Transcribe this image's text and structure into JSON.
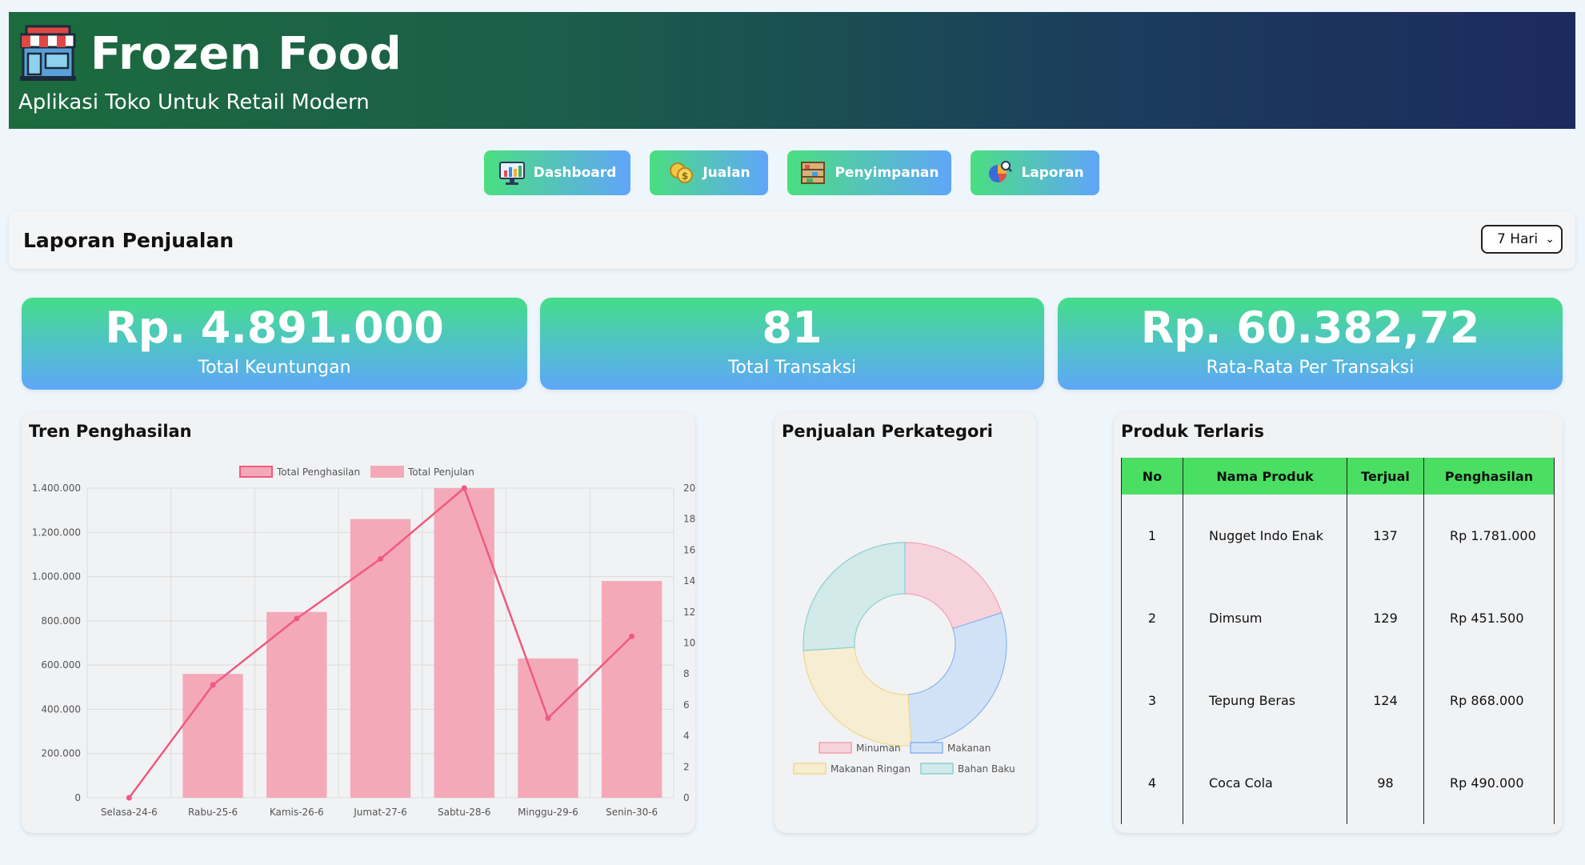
{
  "header": {
    "title": "Frozen Food",
    "subtitle": "Aplikasi Toko Untuk Retail Modern"
  },
  "nav": [
    {
      "label": "Dashboard",
      "icon": "monitor-chart-icon"
    },
    {
      "label": "Jualan",
      "icon": "coins-icon"
    },
    {
      "label": "Penyimpanan",
      "icon": "storage-shelf-icon"
    },
    {
      "label": "Laporan",
      "icon": "analytics-report-icon"
    }
  ],
  "report": {
    "title": "Laporan Penjualan",
    "period_selected": "7 Hari"
  },
  "stats": [
    {
      "value": "Rp. 4.891.000",
      "label": "Total Keuntungan"
    },
    {
      "value": "81",
      "label": "Total Transaksi"
    },
    {
      "value": "Rp. 60.382,72",
      "label": "Rata-Rata Per Transaksi"
    }
  ],
  "trend_panel": {
    "title": "Tren Penghasilan"
  },
  "category_panel": {
    "title": "Penjualan Perkategori"
  },
  "top_products": {
    "title": "Produk Terlaris",
    "headers": [
      "No",
      "Nama Produk",
      "Terjual",
      "Penghasilan"
    ],
    "rows": [
      [
        "1",
        "Nugget Indo Enak",
        "137",
        "Rp 1.781.000"
      ],
      [
        "2",
        "Dimsum",
        "129",
        "Rp 451.500"
      ],
      [
        "3",
        "Tepung Beras",
        "124",
        "Rp 868.000"
      ],
      [
        "4",
        "Coca Cola",
        "98",
        "Rp 490.000"
      ]
    ]
  },
  "colors": {
    "accent_green": "#4ade80",
    "accent_blue": "#60a5fa",
    "line": "#f05a7e",
    "bar": "#f4a9b9"
  },
  "chart_data": [
    {
      "type": "bar",
      "categories": [
        "Selasa-24-6",
        "Rabu-25-6",
        "Kamis-26-6",
        "Jumat-27-6",
        "Sabtu-28-6",
        "Minggu-29-6",
        "Senin-30-6"
      ],
      "series": [
        {
          "name": "Total Penghasilan",
          "type": "line",
          "axis": "left",
          "values": [
            0,
            510000,
            810000,
            1080000,
            1400000,
            360000,
            730000
          ]
        },
        {
          "name": "Total Penjulan",
          "type": "bar",
          "axis": "right",
          "values": [
            0,
            8,
            12,
            18,
            20,
            9,
            14
          ]
        }
      ],
      "ylim_left": [
        0,
        1400000
      ],
      "yticks_left": [
        "0",
        "200.000",
        "400.000",
        "600.000",
        "800.000",
        "1.000.000",
        "1.200.000",
        "1.400.000"
      ],
      "ylim_right": [
        0,
        20
      ],
      "yticks_right": [
        "0",
        "2",
        "4",
        "6",
        "8",
        "10",
        "12",
        "14",
        "16",
        "18",
        "20"
      ],
      "legend": "top",
      "grid": true
    },
    {
      "type": "pie",
      "donut": true,
      "categories": [
        "Minuman",
        "Makanan",
        "Makanan Ringan",
        "Bahan Baku"
      ],
      "values": [
        20,
        29,
        25,
        26
      ],
      "colors": [
        "#f6d3dc",
        "#d2e2f6",
        "#f6edd2",
        "#d2eaea"
      ],
      "stroke_colors": [
        "#f0a0b4",
        "#8ab4f0",
        "#f0d890",
        "#8ccfcf"
      ],
      "legend": "bottom"
    }
  ]
}
